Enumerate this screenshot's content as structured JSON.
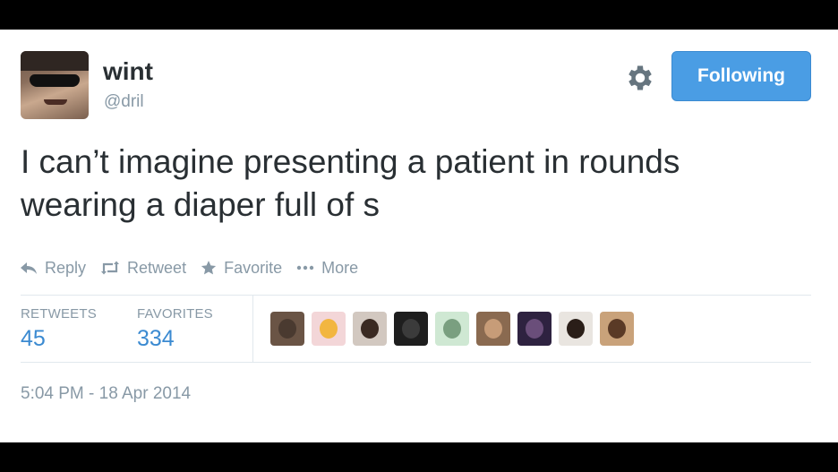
{
  "user": {
    "name": "wint",
    "handle": "@dril"
  },
  "header": {
    "follow_label": "Following"
  },
  "tweet": {
    "text_line1": "I can’t imagine presenting a patient in rounds",
    "text_line2": "wearing a diaper full of s"
  },
  "actions": {
    "reply": "Reply",
    "retweet": "Retweet",
    "favorite": "Favorite",
    "more": "More"
  },
  "stats": {
    "retweets_label": "RETWEETS",
    "retweets_count": "45",
    "favorites_label": "FAVORITES",
    "favorites_count": "334"
  },
  "favoriters": [
    {
      "bg": "#6a5445",
      "head": "#4a3a30"
    },
    {
      "bg": "#f3d6d8",
      "head": "#f2b640"
    },
    {
      "bg": "#d2c8c0",
      "head": "#3a2a22"
    },
    {
      "bg": "#1e1e1e",
      "head": "#3b3b3b"
    },
    {
      "bg": "#cfe8d3",
      "head": "#7a9f80"
    },
    {
      "bg": "#8a6a50",
      "head": "#c79c78"
    },
    {
      "bg": "#2e2240",
      "head": "#6a4e7a"
    },
    {
      "bg": "#e9e5e0",
      "head": "#2a1e18"
    },
    {
      "bg": "#c9a27a",
      "head": "#5a3a26"
    }
  ],
  "timestamp": "5:04 PM - 18 Apr 2014",
  "colors": {
    "accent": "#4a9de4",
    "count_blue": "#3b8ad1",
    "muted": "#8899a6",
    "text": "#292f33"
  }
}
